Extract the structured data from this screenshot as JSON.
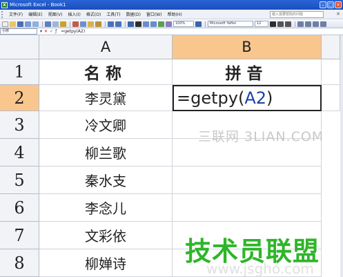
{
  "window": {
    "title": "Microsoft Excel - Book1",
    "app_icon": "X"
  },
  "menubar": {
    "items": [
      "文件(F)",
      "编辑(E)",
      "视图(V)",
      "插入(I)",
      "格式(O)",
      "工具(T)",
      "数据(D)",
      "窗口(W)",
      "帮助(H)"
    ],
    "help_placeholder": "键入需要帮助的问题"
  },
  "toolbar": {
    "zoom": "100%",
    "font_name": "Microsoft YaHei",
    "font_size": "12"
  },
  "formula_bar": {
    "name_box": "引修",
    "formula": "=getpy(A2)"
  },
  "sheet": {
    "columns": [
      "A",
      "B"
    ],
    "rows": [
      "1",
      "2",
      "3",
      "4",
      "5",
      "6",
      "7",
      "8"
    ],
    "header_a": "名称",
    "header_b": "拼音",
    "names": [
      "李灵黛",
      "冷文卿",
      "柳兰歌",
      "秦水支",
      "李念儿",
      "文彩依",
      "柳婵诗"
    ],
    "active_formula_prefix": "=getpy(",
    "active_formula_arg": "A2",
    "active_formula_suffix": ")"
  },
  "watermarks": {
    "sanlian": "三联网 3LIAN.COM",
    "brand": "技术员联盟",
    "url": "www.jsgho.com"
  },
  "colors": {
    "active_header": "#f9c68e",
    "formula_arg": "#1b3fa8",
    "watermark_green": "#2fb52a"
  }
}
